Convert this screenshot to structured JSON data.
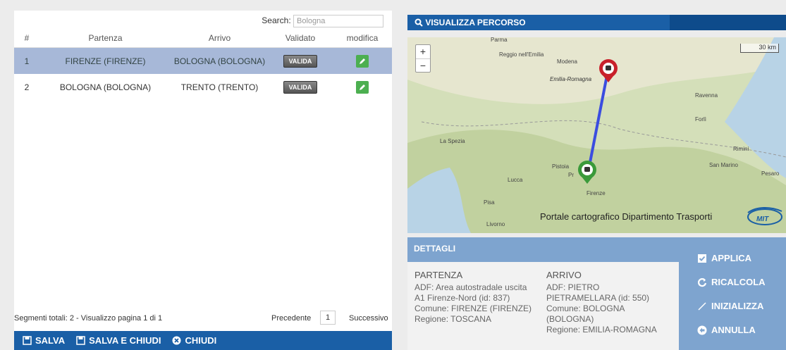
{
  "search": {
    "label": "Search:",
    "value": "Bologna"
  },
  "table": {
    "headers": [
      "#",
      "Partenza",
      "Arrivo",
      "Validato",
      "modifica"
    ],
    "rows": [
      {
        "num": "1",
        "partenza": "FIRENZE (FIRENZE)",
        "arrivo": "BOLOGNA (BOLOGNA)",
        "validato": "VALIDA"
      },
      {
        "num": "2",
        "partenza": "BOLOGNA (BOLOGNA)",
        "arrivo": "TRENTO (TRENTO)",
        "validato": "VALIDA"
      }
    ]
  },
  "pagination": {
    "info": "Segmenti totali: 2 - Visualizzo pagina 1 di 1",
    "prev": "Precedente",
    "page": "1",
    "next": "Successivo"
  },
  "bottombar": {
    "salva": "SALVA",
    "salva_chiudi": "SALVA E CHIUDI",
    "chiudi": "CHIUDI"
  },
  "map": {
    "title": "VISUALIZZA PERCORSO",
    "zoom_in": "+",
    "zoom_out": "−",
    "scale": "30 km",
    "labels": {
      "parma": "Parma",
      "reggio": "Reggio nell'Emilia",
      "modena": "Modena",
      "emilia": "Emilia-Romagna",
      "ravenna": "Ravenna",
      "forli": "Forlì",
      "rimini": "Rimini",
      "sanmarino": "San Marino",
      "pesaro": "Pesaro",
      "laspezia": "La Spezia",
      "pistoia": "Pistoia",
      "prato": "Pr",
      "lucca": "Lucca",
      "firenze": "Firenze",
      "pisa": "Pisa",
      "livorno": "Livorno"
    },
    "attribution": "Portale cartografico Dipartimento Trasporti",
    "logo": "MIT"
  },
  "details": {
    "title": "DETTAGLI",
    "partenza": {
      "head": "PARTENZA",
      "lines": [
        "ADF: Area autostradale uscita",
        "A1 Firenze-Nord (id: 837)",
        "Comune: FIRENZE (FIRENZE)",
        "Regione: TOSCANA"
      ]
    },
    "arrivo": {
      "head": "ARRIVO",
      "lines": [
        "ADF: PIETRO",
        "PIETRAMELLARA (id: 550)",
        "Comune: BOLOGNA",
        "(BOLOGNA)",
        "Regione: EMILIA-ROMAGNA"
      ]
    }
  },
  "actions": {
    "applica": "APPLICA",
    "ricalcola": "RICALCOLA",
    "inizializza": "INIZIALIZZA",
    "annulla": "ANNULLA"
  },
  "colors": {
    "primary": "#1a5fa6",
    "selected_row": "#a7b8d8",
    "details_bg": "#7ea4cf",
    "route": "#3b4de0",
    "marker_start": "#3a9a3a",
    "marker_end": "#c8202a"
  }
}
